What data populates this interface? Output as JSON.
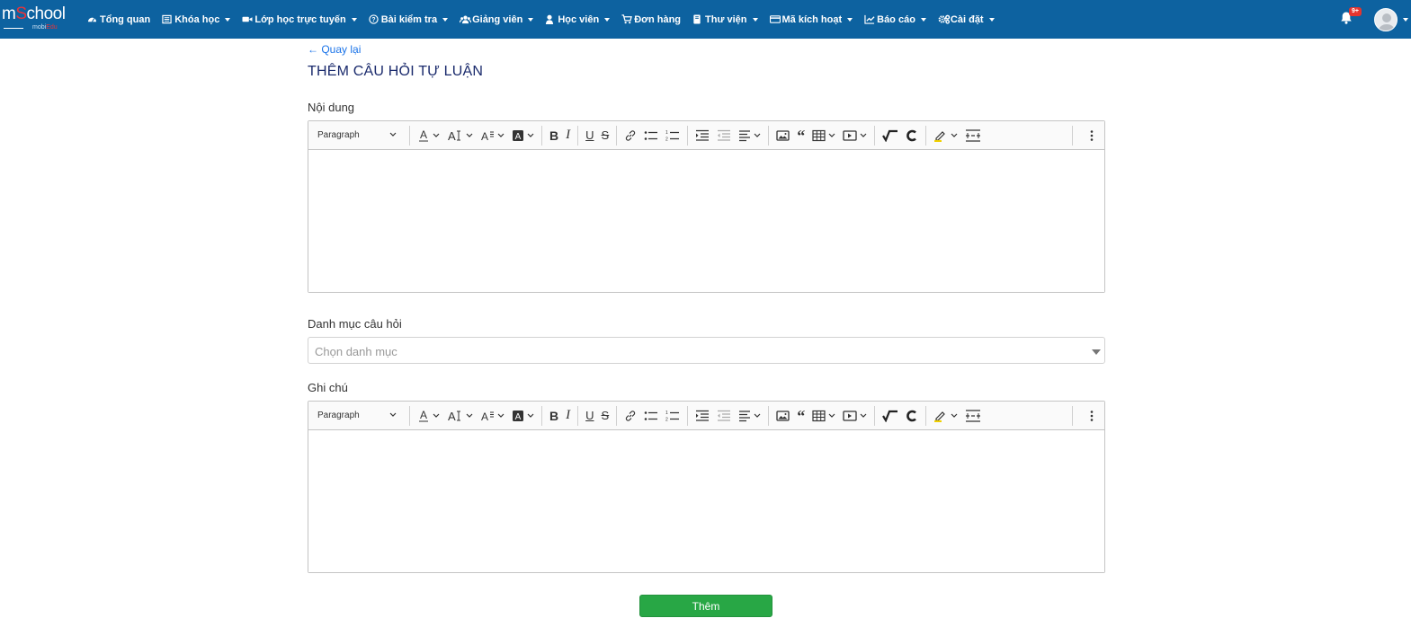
{
  "brand": {
    "logo_main_a": "m",
    "logo_main_red": "S",
    "logo_main_b": "chool",
    "logo_sub_a": "mobi",
    "logo_sub_red": "Edu",
    "accent": "#0d62a0"
  },
  "nav": {
    "items": [
      {
        "label": "Tổng quan",
        "icon": "dashboard-icon",
        "dropdown": false
      },
      {
        "label": "Khóa học",
        "icon": "list-icon",
        "dropdown": true
      },
      {
        "label": "Lớp học trực tuyến",
        "icon": "video-icon",
        "dropdown": true
      },
      {
        "label": "Bài kiểm tra",
        "icon": "question-icon",
        "dropdown": true
      },
      {
        "label": "Giảng viên",
        "icon": "users-icon",
        "dropdown": true
      },
      {
        "label": "Học viên",
        "icon": "user-icon",
        "dropdown": true
      },
      {
        "label": "Đơn hàng",
        "icon": "cart-icon",
        "dropdown": false
      },
      {
        "label": "Thư viện",
        "icon": "book-icon",
        "dropdown": true
      },
      {
        "label": "Mã kích hoạt",
        "icon": "card-icon",
        "dropdown": true
      },
      {
        "label": "Báo cáo",
        "icon": "chart-icon",
        "dropdown": true
      },
      {
        "label": "Cài đặt",
        "icon": "cogs-icon",
        "dropdown": true
      }
    ],
    "notification_badge": "9+"
  },
  "page": {
    "back_label": "Quay lại",
    "title": "THÊM CÂU HỎI TỰ LUẬN",
    "content_label": "Nội dung",
    "category_label": "Danh mục câu hỏi",
    "category_placeholder": "Chọn danh mục",
    "note_label": "Ghi chú",
    "submit_label": "Thêm"
  },
  "editor": {
    "paragraph_label": "Paragraph"
  }
}
